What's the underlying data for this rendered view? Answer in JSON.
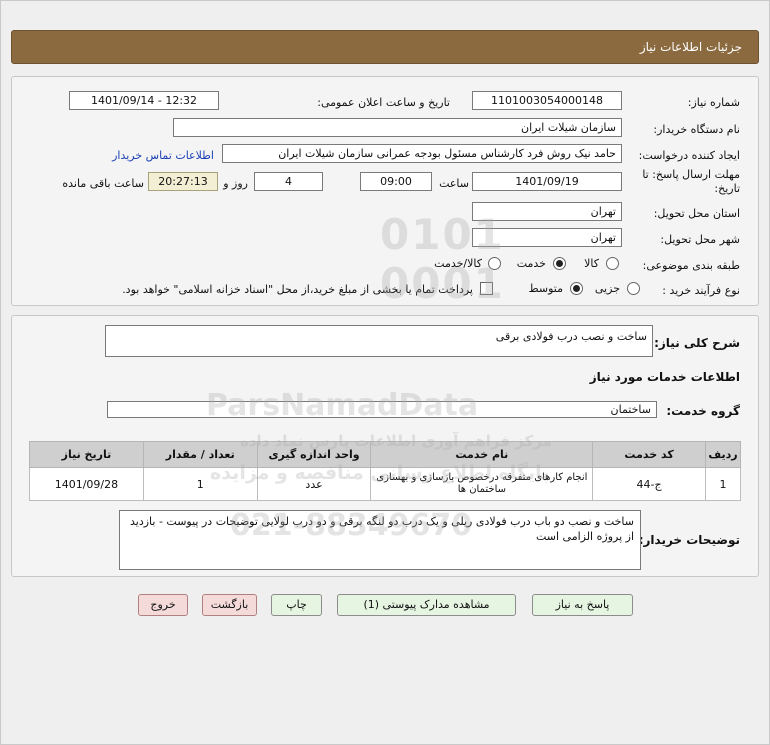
{
  "header": {
    "title": "جزئیات اطلاعات نیاز"
  },
  "form": {
    "need_number_label": "شماره نیاز:",
    "need_number": "1101003054000148",
    "announce_label": "تاریخ و ساعت اعلان عمومی:",
    "announce_value": "1401/09/14 - 12:32",
    "buyer_org_label": "نام دستگاه خریدار:",
    "buyer_org": "سازمان شیلات ایران",
    "creator_label": "ایجاد کننده درخواست:",
    "creator": "حامد نیک روش فرد کارشناس مسئول بودجه عمرانی سازمان شیلات ایران",
    "contact_link": "اطلاعات تماس خریدار",
    "deadline_label_1": "مهلت ارسال پاسخ: تا",
    "deadline_label_2": "تاریخ:",
    "deadline_date": "1401/09/19",
    "time_label": "ساعت",
    "deadline_time": "09:00",
    "days_value": "4",
    "days_label": "روز و",
    "remaining_time": "20:27:13",
    "remaining_label": "ساعت باقی مانده",
    "province_label": "استان محل تحویل:",
    "province": "تهران",
    "city_label": "شهر محل تحویل:",
    "city": "تهران",
    "category_label": "طبقه بندی موضوعی:",
    "category_options": [
      "کالا",
      "خدمت",
      "کالا/خدمت"
    ],
    "category_selected": "خدمت",
    "process_label": "نوع فرآیند خرید :",
    "process_options": [
      "جزیی",
      "متوسط"
    ],
    "process_selected": "متوسط",
    "treasury_text": "پرداخت تمام یا بخشی از مبلغ خرید،از محل \"اسناد خزانه اسلامی\" خواهد بود."
  },
  "summary": {
    "label": "شرح کلی نیاز:",
    "value": "ساخت و نصب درب فولادی برقی",
    "services_title": "اطلاعات خدمات مورد نیاز",
    "group_label": "گروه خدمت:",
    "group_value": "ساختمان"
  },
  "table": {
    "headers": [
      "ردیف",
      "کد خدمت",
      "نام خدمت",
      "واحد اندازه گیری",
      "تعداد / مقدار",
      "تاریخ نیاز"
    ],
    "rows": [
      [
        "1",
        "ج-44",
        "انجام کارهای متفرقه درخصوص بازسازی و بهسازی ساختمان ها",
        "عدد",
        "1",
        "1401/09/28"
      ]
    ]
  },
  "buyer_notes": {
    "label": "توضیحات خریدار:",
    "text": "ساخت و نصب دو باب درب فولادی ریلی و یک درب دو لنگه برقی و دو درب لولایی توضیحات در پیوست - بازدید از پروژه الزامی است"
  },
  "buttons": {
    "respond": "پاسخ به نیاز",
    "attachments": "مشاهده مدارک پیوستی (1)",
    "print": "چاپ",
    "back": "بازگشت",
    "exit": "خروج"
  },
  "watermark": {
    "brand": "ParsNamadData",
    "line1": "مرکز فراهم آوری اطلاعات پارس نماد داده",
    "line2": "پایگاه اطلاع رسانی مناقصه و مزایده",
    "phone": "021-88349670"
  }
}
